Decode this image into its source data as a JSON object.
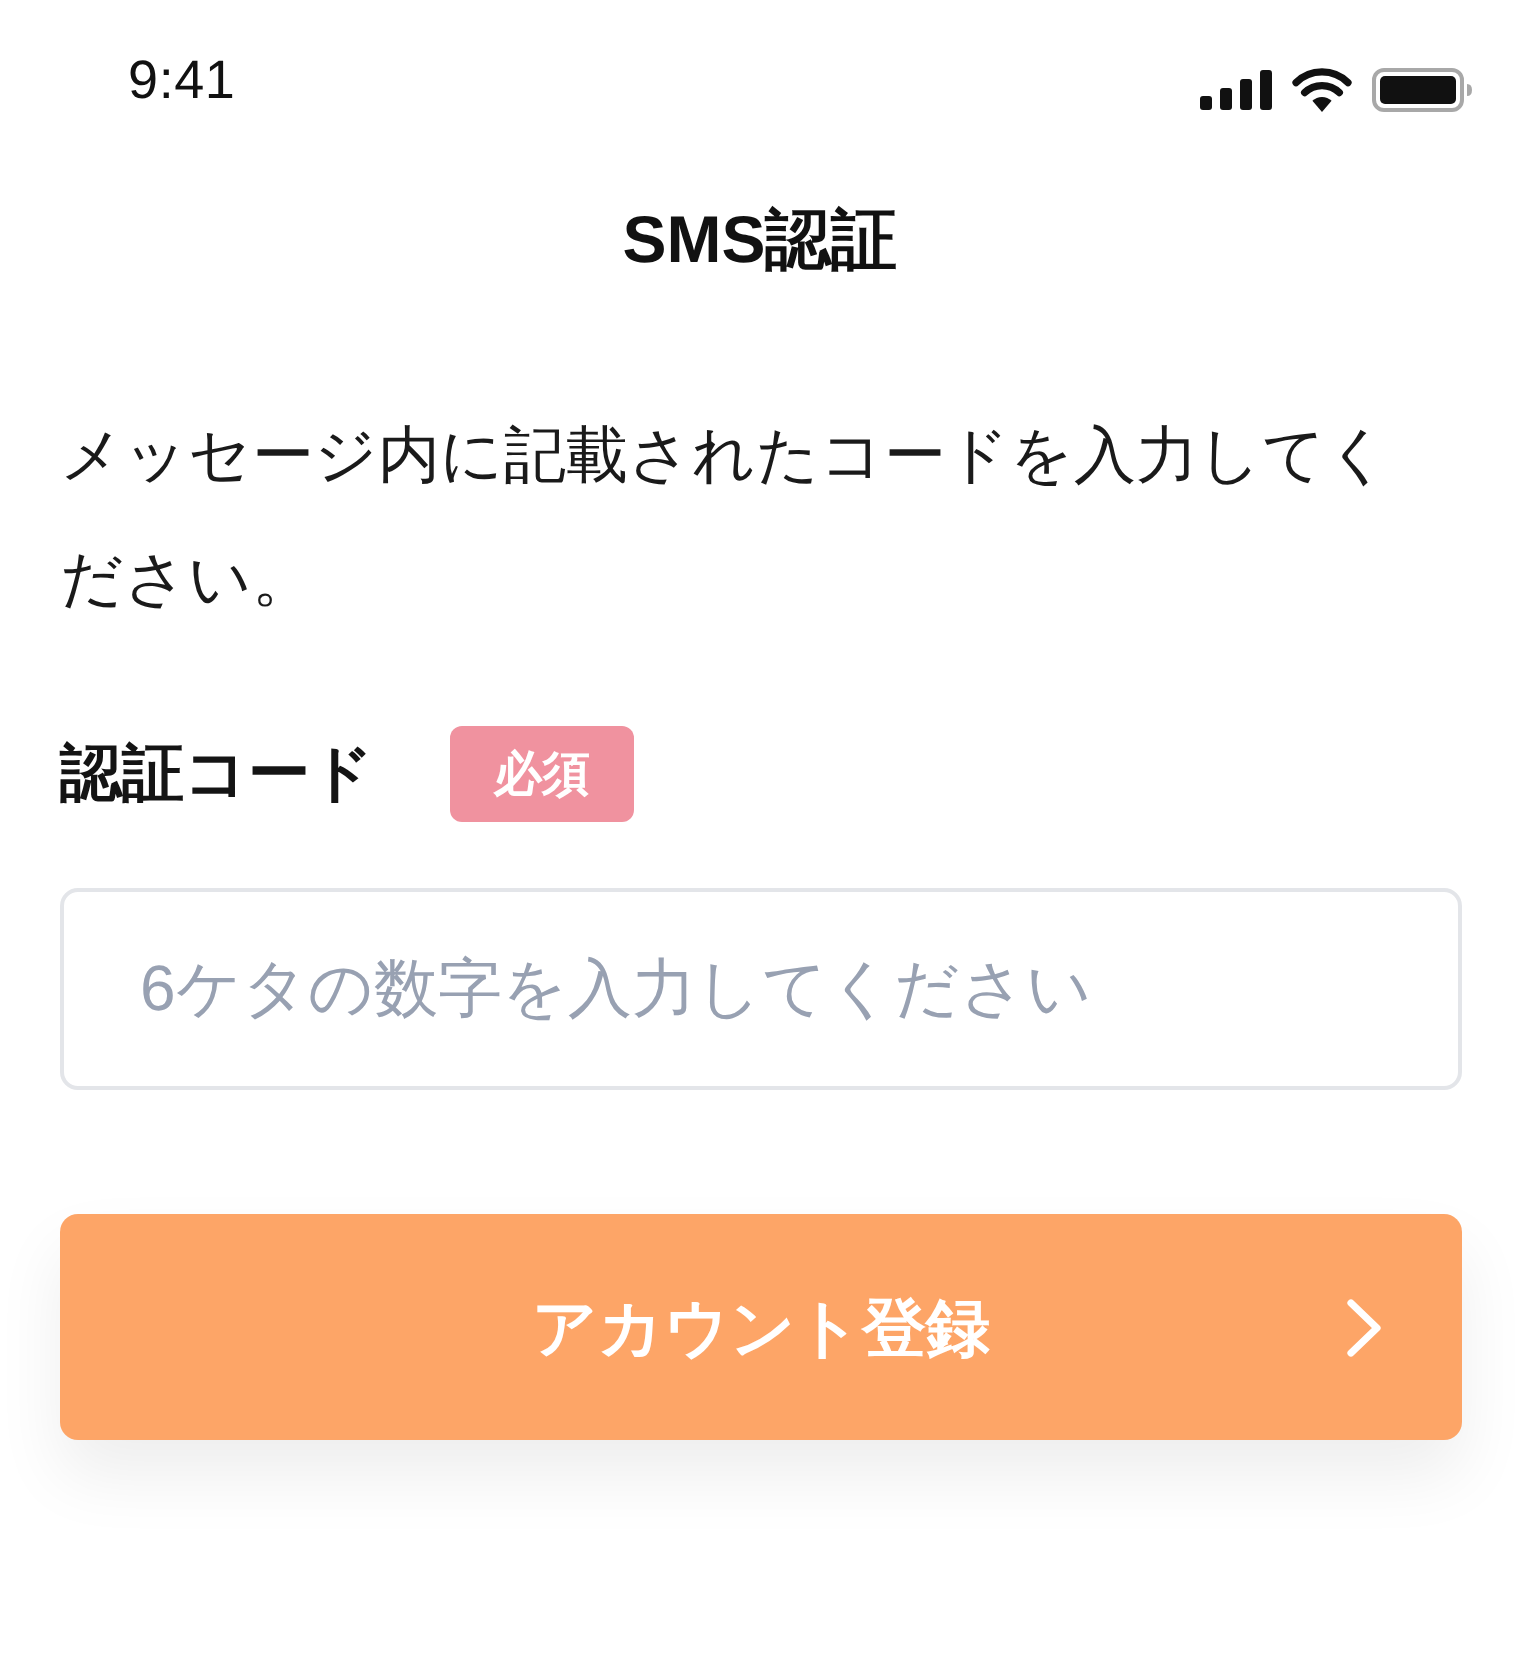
{
  "status_bar": {
    "time": "9:41"
  },
  "header": {
    "title": "SMS認証"
  },
  "message": "メッセージ内に記載されたコードを入力してください。",
  "field": {
    "label": "認証コード",
    "badge": "必須",
    "placeholder": "6ケタの数字を入力してください"
  },
  "submit_button": {
    "label": "アカウント登録"
  }
}
